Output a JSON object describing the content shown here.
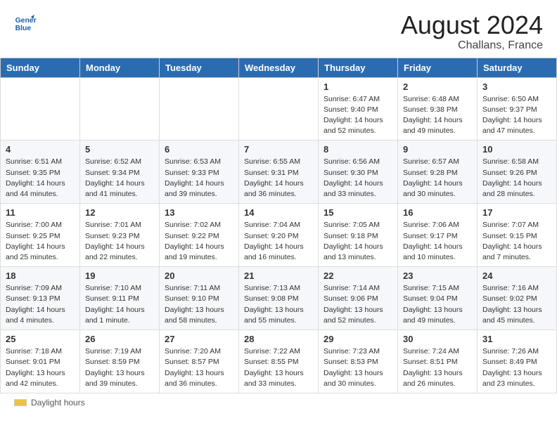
{
  "header": {
    "month_year": "August 2024",
    "location": "Challans, France",
    "logo_line1": "General",
    "logo_line2": "Blue"
  },
  "days_of_week": [
    "Sunday",
    "Monday",
    "Tuesday",
    "Wednesday",
    "Thursday",
    "Friday",
    "Saturday"
  ],
  "weeks": [
    [
      {
        "day": "",
        "info": ""
      },
      {
        "day": "",
        "info": ""
      },
      {
        "day": "",
        "info": ""
      },
      {
        "day": "",
        "info": ""
      },
      {
        "day": "1",
        "info": "Sunrise: 6:47 AM\nSunset: 9:40 PM\nDaylight: 14 hours and 52 minutes."
      },
      {
        "day": "2",
        "info": "Sunrise: 6:48 AM\nSunset: 9:38 PM\nDaylight: 14 hours and 49 minutes."
      },
      {
        "day": "3",
        "info": "Sunrise: 6:50 AM\nSunset: 9:37 PM\nDaylight: 14 hours and 47 minutes."
      }
    ],
    [
      {
        "day": "4",
        "info": "Sunrise: 6:51 AM\nSunset: 9:35 PM\nDaylight: 14 hours and 44 minutes."
      },
      {
        "day": "5",
        "info": "Sunrise: 6:52 AM\nSunset: 9:34 PM\nDaylight: 14 hours and 41 minutes."
      },
      {
        "day": "6",
        "info": "Sunrise: 6:53 AM\nSunset: 9:33 PM\nDaylight: 14 hours and 39 minutes."
      },
      {
        "day": "7",
        "info": "Sunrise: 6:55 AM\nSunset: 9:31 PM\nDaylight: 14 hours and 36 minutes."
      },
      {
        "day": "8",
        "info": "Sunrise: 6:56 AM\nSunset: 9:30 PM\nDaylight: 14 hours and 33 minutes."
      },
      {
        "day": "9",
        "info": "Sunrise: 6:57 AM\nSunset: 9:28 PM\nDaylight: 14 hours and 30 minutes."
      },
      {
        "day": "10",
        "info": "Sunrise: 6:58 AM\nSunset: 9:26 PM\nDaylight: 14 hours and 28 minutes."
      }
    ],
    [
      {
        "day": "11",
        "info": "Sunrise: 7:00 AM\nSunset: 9:25 PM\nDaylight: 14 hours and 25 minutes."
      },
      {
        "day": "12",
        "info": "Sunrise: 7:01 AM\nSunset: 9:23 PM\nDaylight: 14 hours and 22 minutes."
      },
      {
        "day": "13",
        "info": "Sunrise: 7:02 AM\nSunset: 9:22 PM\nDaylight: 14 hours and 19 minutes."
      },
      {
        "day": "14",
        "info": "Sunrise: 7:04 AM\nSunset: 9:20 PM\nDaylight: 14 hours and 16 minutes."
      },
      {
        "day": "15",
        "info": "Sunrise: 7:05 AM\nSunset: 9:18 PM\nDaylight: 14 hours and 13 minutes."
      },
      {
        "day": "16",
        "info": "Sunrise: 7:06 AM\nSunset: 9:17 PM\nDaylight: 14 hours and 10 minutes."
      },
      {
        "day": "17",
        "info": "Sunrise: 7:07 AM\nSunset: 9:15 PM\nDaylight: 14 hours and 7 minutes."
      }
    ],
    [
      {
        "day": "18",
        "info": "Sunrise: 7:09 AM\nSunset: 9:13 PM\nDaylight: 14 hours and 4 minutes."
      },
      {
        "day": "19",
        "info": "Sunrise: 7:10 AM\nSunset: 9:11 PM\nDaylight: 14 hours and 1 minute."
      },
      {
        "day": "20",
        "info": "Sunrise: 7:11 AM\nSunset: 9:10 PM\nDaylight: 13 hours and 58 minutes."
      },
      {
        "day": "21",
        "info": "Sunrise: 7:13 AM\nSunset: 9:08 PM\nDaylight: 13 hours and 55 minutes."
      },
      {
        "day": "22",
        "info": "Sunrise: 7:14 AM\nSunset: 9:06 PM\nDaylight: 13 hours and 52 minutes."
      },
      {
        "day": "23",
        "info": "Sunrise: 7:15 AM\nSunset: 9:04 PM\nDaylight: 13 hours and 49 minutes."
      },
      {
        "day": "24",
        "info": "Sunrise: 7:16 AM\nSunset: 9:02 PM\nDaylight: 13 hours and 45 minutes."
      }
    ],
    [
      {
        "day": "25",
        "info": "Sunrise: 7:18 AM\nSunset: 9:01 PM\nDaylight: 13 hours and 42 minutes."
      },
      {
        "day": "26",
        "info": "Sunrise: 7:19 AM\nSunset: 8:59 PM\nDaylight: 13 hours and 39 minutes."
      },
      {
        "day": "27",
        "info": "Sunrise: 7:20 AM\nSunset: 8:57 PM\nDaylight: 13 hours and 36 minutes."
      },
      {
        "day": "28",
        "info": "Sunrise: 7:22 AM\nSunset: 8:55 PM\nDaylight: 13 hours and 33 minutes."
      },
      {
        "day": "29",
        "info": "Sunrise: 7:23 AM\nSunset: 8:53 PM\nDaylight: 13 hours and 30 minutes."
      },
      {
        "day": "30",
        "info": "Sunrise: 7:24 AM\nSunset: 8:51 PM\nDaylight: 13 hours and 26 minutes."
      },
      {
        "day": "31",
        "info": "Sunrise: 7:26 AM\nSunset: 8:49 PM\nDaylight: 13 hours and 23 minutes."
      }
    ]
  ],
  "legend": {
    "label": "Daylight hours"
  }
}
